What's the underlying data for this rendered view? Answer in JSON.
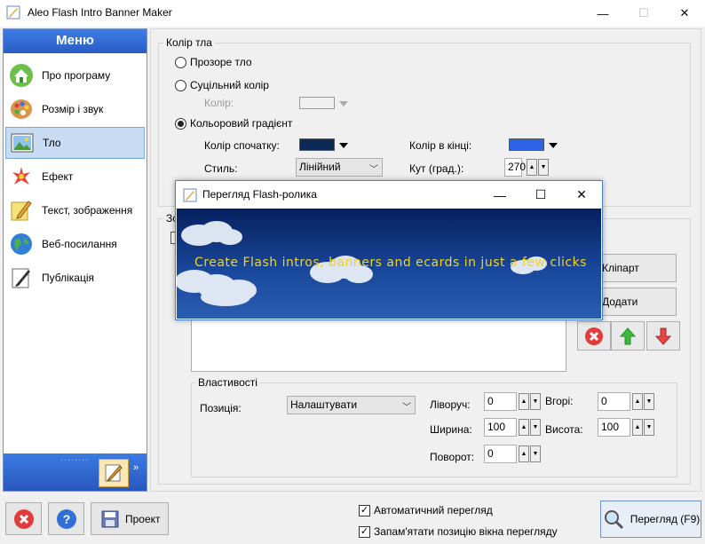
{
  "window": {
    "title": "Aleo Flash Intro Banner Maker",
    "minimize": "—",
    "maximize": "☐",
    "close": "✕"
  },
  "sidebar": {
    "header": "Меню",
    "items": [
      {
        "label": "Про програму",
        "icon": "home-icon"
      },
      {
        "label": "Розмір і звук",
        "icon": "palette-icon"
      },
      {
        "label": "Тло",
        "icon": "picture-icon"
      },
      {
        "label": "Ефект",
        "icon": "sparkle-icon"
      },
      {
        "label": "Текст, зображення",
        "icon": "pencil-icon"
      },
      {
        "label": "Веб-посилання",
        "icon": "globe-icon"
      },
      {
        "label": "Публікація",
        "icon": "publish-icon"
      }
    ],
    "more": "»"
  },
  "background_group": {
    "legend": "Колір тла",
    "transparent_label": "Прозоре тло",
    "solid_label": "Суцільний колір",
    "solid_color_label": "Колір:",
    "gradient_label": "Кольоровий градієнт",
    "start_color_label": "Колір спочатку:",
    "end_color_label": "Колір в кінці:",
    "style_label": "Стиль:",
    "style_value": "Лінійний",
    "angle_label": "Кут (град.):",
    "angle_value": "270",
    "start_color": "#0b2a55",
    "end_color": "#2f63e6",
    "solid_color": "#f0f0f0"
  },
  "images_group": {
    "legend_partial": "Зо",
    "clipart_label": "Кліпарт",
    "add_label": "Додати"
  },
  "properties": {
    "legend": "Властивості",
    "position_label": "Позиція:",
    "position_value": "Налаштувати",
    "left_label": "Ліворуч:",
    "left_value": "0",
    "top_label": "Вгорі:",
    "top_value": "0",
    "width_label": "Ширина:",
    "width_value": "100",
    "height_label": "Висота:",
    "height_value": "100",
    "rotate_label": "Поворот:",
    "rotate_value": "0"
  },
  "bottom": {
    "project_label": "Проект",
    "auto_preview_label": "Автоматичний перегляд",
    "remember_position_label": "Запам'ятати позицію вікна перегляду",
    "preview_label": "Перегляд (F9)"
  },
  "preview_window": {
    "title": "Перегляд Flash-ролика",
    "banner_text": "Create Flash intros, banners and ecards in just a few clicks",
    "minimize": "—",
    "maximize": "☐",
    "close": "✕"
  },
  "colors": {
    "accent": "#2a5cc4",
    "selection": "#c7dcf3",
    "stage_top": "#06205f",
    "banner_text": "#f4d320"
  }
}
